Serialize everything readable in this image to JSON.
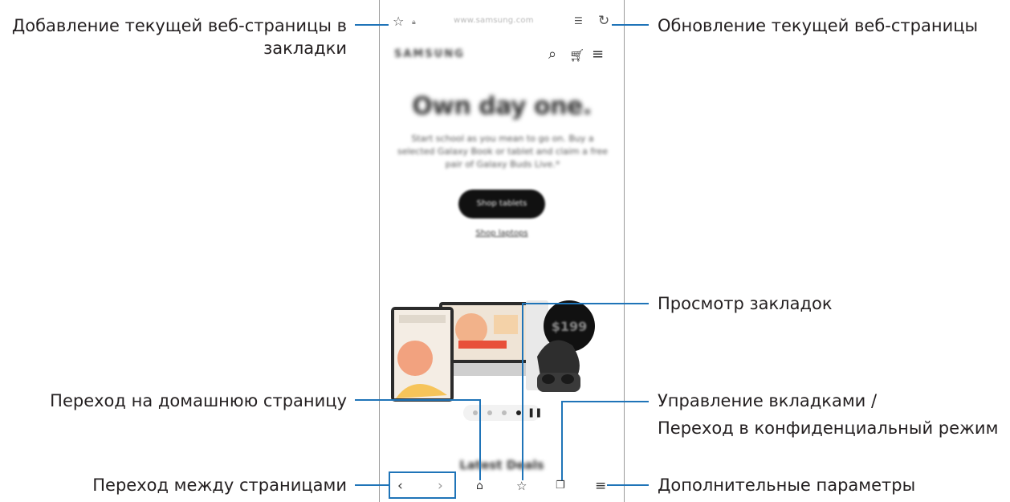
{
  "labels": {
    "add_bookmark": [
      "Добавление текущей веб-страницы в",
      "закладки"
    ],
    "refresh": "Обновление текущей веб-страницы",
    "view_bookmarks": "Просмотр закладок",
    "home": "Переход на домашнюю страницу",
    "tabs": [
      "Управление вкладками /",
      "Переход в конфиденциальный режим"
    ],
    "navigate": "Переход между страницами",
    "more": "Дополнительные параметры"
  },
  "browser": {
    "url": "www.samsung.com",
    "site_logo": "SAMSUNG",
    "hero_title": "Own day one.",
    "hero_subtitle": "Start school as you mean to go on. Buy a selected Galaxy Book or tablet and claim a free pair of Galaxy Buds Live.*",
    "hero_button": "Shop tablets",
    "hero_link": "Shop laptops",
    "price_badge": "$199",
    "section_title": "Latest Deals"
  },
  "colors": {
    "callout_line": "#1f74b8",
    "text": "#231f20"
  },
  "icons": [
    "star-icon",
    "lock-icon",
    "reader-mode-icon",
    "refresh-icon",
    "search-icon",
    "cart-icon",
    "menu-icon",
    "back-icon",
    "forward-icon",
    "home-icon",
    "bookmarks-icon",
    "tabs-icon",
    "more-icon",
    "pause-icon"
  ]
}
